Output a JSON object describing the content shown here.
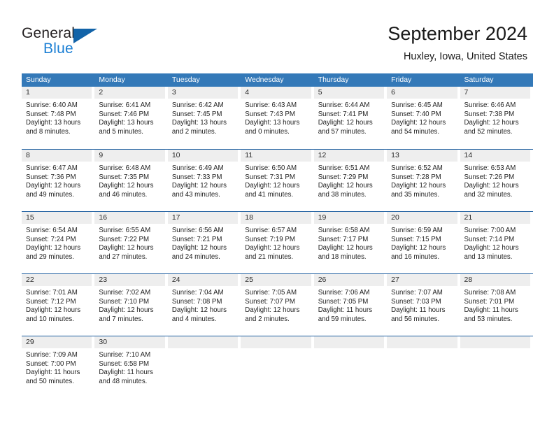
{
  "brand": {
    "word_general": "General",
    "word_blue": "Blue",
    "logo_icon": "triangle-logo-icon",
    "accent_color": "#1263a8",
    "blue_text_color": "#1b7fd4"
  },
  "header": {
    "title": "September 2024",
    "subtitle": "Huxley, Iowa, United States"
  },
  "calendar": {
    "header_bg": "#3479b8",
    "row_divider_color": "#1f5fa0",
    "daynum_strip_bg": "#eeeeee",
    "weekdays": [
      "Sunday",
      "Monday",
      "Tuesday",
      "Wednesday",
      "Thursday",
      "Friday",
      "Saturday"
    ],
    "weeks": [
      [
        {
          "day": "1",
          "sunrise": "Sunrise: 6:40 AM",
          "sunset": "Sunset: 7:48 PM",
          "daylight_1": "Daylight: 13 hours",
          "daylight_2": "and 8 minutes."
        },
        {
          "day": "2",
          "sunrise": "Sunrise: 6:41 AM",
          "sunset": "Sunset: 7:46 PM",
          "daylight_1": "Daylight: 13 hours",
          "daylight_2": "and 5 minutes."
        },
        {
          "day": "3",
          "sunrise": "Sunrise: 6:42 AM",
          "sunset": "Sunset: 7:45 PM",
          "daylight_1": "Daylight: 13 hours",
          "daylight_2": "and 2 minutes."
        },
        {
          "day": "4",
          "sunrise": "Sunrise: 6:43 AM",
          "sunset": "Sunset: 7:43 PM",
          "daylight_1": "Daylight: 13 hours",
          "daylight_2": "and 0 minutes."
        },
        {
          "day": "5",
          "sunrise": "Sunrise: 6:44 AM",
          "sunset": "Sunset: 7:41 PM",
          "daylight_1": "Daylight: 12 hours",
          "daylight_2": "and 57 minutes."
        },
        {
          "day": "6",
          "sunrise": "Sunrise: 6:45 AM",
          "sunset": "Sunset: 7:40 PM",
          "daylight_1": "Daylight: 12 hours",
          "daylight_2": "and 54 minutes."
        },
        {
          "day": "7",
          "sunrise": "Sunrise: 6:46 AM",
          "sunset": "Sunset: 7:38 PM",
          "daylight_1": "Daylight: 12 hours",
          "daylight_2": "and 52 minutes."
        }
      ],
      [
        {
          "day": "8",
          "sunrise": "Sunrise: 6:47 AM",
          "sunset": "Sunset: 7:36 PM",
          "daylight_1": "Daylight: 12 hours",
          "daylight_2": "and 49 minutes."
        },
        {
          "day": "9",
          "sunrise": "Sunrise: 6:48 AM",
          "sunset": "Sunset: 7:35 PM",
          "daylight_1": "Daylight: 12 hours",
          "daylight_2": "and 46 minutes."
        },
        {
          "day": "10",
          "sunrise": "Sunrise: 6:49 AM",
          "sunset": "Sunset: 7:33 PM",
          "daylight_1": "Daylight: 12 hours",
          "daylight_2": "and 43 minutes."
        },
        {
          "day": "11",
          "sunrise": "Sunrise: 6:50 AM",
          "sunset": "Sunset: 7:31 PM",
          "daylight_1": "Daylight: 12 hours",
          "daylight_2": "and 41 minutes."
        },
        {
          "day": "12",
          "sunrise": "Sunrise: 6:51 AM",
          "sunset": "Sunset: 7:29 PM",
          "daylight_1": "Daylight: 12 hours",
          "daylight_2": "and 38 minutes."
        },
        {
          "day": "13",
          "sunrise": "Sunrise: 6:52 AM",
          "sunset": "Sunset: 7:28 PM",
          "daylight_1": "Daylight: 12 hours",
          "daylight_2": "and 35 minutes."
        },
        {
          "day": "14",
          "sunrise": "Sunrise: 6:53 AM",
          "sunset": "Sunset: 7:26 PM",
          "daylight_1": "Daylight: 12 hours",
          "daylight_2": "and 32 minutes."
        }
      ],
      [
        {
          "day": "15",
          "sunrise": "Sunrise: 6:54 AM",
          "sunset": "Sunset: 7:24 PM",
          "daylight_1": "Daylight: 12 hours",
          "daylight_2": "and 29 minutes."
        },
        {
          "day": "16",
          "sunrise": "Sunrise: 6:55 AM",
          "sunset": "Sunset: 7:22 PM",
          "daylight_1": "Daylight: 12 hours",
          "daylight_2": "and 27 minutes."
        },
        {
          "day": "17",
          "sunrise": "Sunrise: 6:56 AM",
          "sunset": "Sunset: 7:21 PM",
          "daylight_1": "Daylight: 12 hours",
          "daylight_2": "and 24 minutes."
        },
        {
          "day": "18",
          "sunrise": "Sunrise: 6:57 AM",
          "sunset": "Sunset: 7:19 PM",
          "daylight_1": "Daylight: 12 hours",
          "daylight_2": "and 21 minutes."
        },
        {
          "day": "19",
          "sunrise": "Sunrise: 6:58 AM",
          "sunset": "Sunset: 7:17 PM",
          "daylight_1": "Daylight: 12 hours",
          "daylight_2": "and 18 minutes."
        },
        {
          "day": "20",
          "sunrise": "Sunrise: 6:59 AM",
          "sunset": "Sunset: 7:15 PM",
          "daylight_1": "Daylight: 12 hours",
          "daylight_2": "and 16 minutes."
        },
        {
          "day": "21",
          "sunrise": "Sunrise: 7:00 AM",
          "sunset": "Sunset: 7:14 PM",
          "daylight_1": "Daylight: 12 hours",
          "daylight_2": "and 13 minutes."
        }
      ],
      [
        {
          "day": "22",
          "sunrise": "Sunrise: 7:01 AM",
          "sunset": "Sunset: 7:12 PM",
          "daylight_1": "Daylight: 12 hours",
          "daylight_2": "and 10 minutes."
        },
        {
          "day": "23",
          "sunrise": "Sunrise: 7:02 AM",
          "sunset": "Sunset: 7:10 PM",
          "daylight_1": "Daylight: 12 hours",
          "daylight_2": "and 7 minutes."
        },
        {
          "day": "24",
          "sunrise": "Sunrise: 7:04 AM",
          "sunset": "Sunset: 7:08 PM",
          "daylight_1": "Daylight: 12 hours",
          "daylight_2": "and 4 minutes."
        },
        {
          "day": "25",
          "sunrise": "Sunrise: 7:05 AM",
          "sunset": "Sunset: 7:07 PM",
          "daylight_1": "Daylight: 12 hours",
          "daylight_2": "and 2 minutes."
        },
        {
          "day": "26",
          "sunrise": "Sunrise: 7:06 AM",
          "sunset": "Sunset: 7:05 PM",
          "daylight_1": "Daylight: 11 hours",
          "daylight_2": "and 59 minutes."
        },
        {
          "day": "27",
          "sunrise": "Sunrise: 7:07 AM",
          "sunset": "Sunset: 7:03 PM",
          "daylight_1": "Daylight: 11 hours",
          "daylight_2": "and 56 minutes."
        },
        {
          "day": "28",
          "sunrise": "Sunrise: 7:08 AM",
          "sunset": "Sunset: 7:01 PM",
          "daylight_1": "Daylight: 11 hours",
          "daylight_2": "and 53 minutes."
        }
      ],
      [
        {
          "day": "29",
          "sunrise": "Sunrise: 7:09 AM",
          "sunset": "Sunset: 7:00 PM",
          "daylight_1": "Daylight: 11 hours",
          "daylight_2": "and 50 minutes."
        },
        {
          "day": "30",
          "sunrise": "Sunrise: 7:10 AM",
          "sunset": "Sunset: 6:58 PM",
          "daylight_1": "Daylight: 11 hours",
          "daylight_2": "and 48 minutes."
        },
        {
          "day": "",
          "sunrise": "",
          "sunset": "",
          "daylight_1": "",
          "daylight_2": ""
        },
        {
          "day": "",
          "sunrise": "",
          "sunset": "",
          "daylight_1": "",
          "daylight_2": ""
        },
        {
          "day": "",
          "sunrise": "",
          "sunset": "",
          "daylight_1": "",
          "daylight_2": ""
        },
        {
          "day": "",
          "sunrise": "",
          "sunset": "",
          "daylight_1": "",
          "daylight_2": ""
        },
        {
          "day": "",
          "sunrise": "",
          "sunset": "",
          "daylight_1": "",
          "daylight_2": ""
        }
      ]
    ]
  }
}
